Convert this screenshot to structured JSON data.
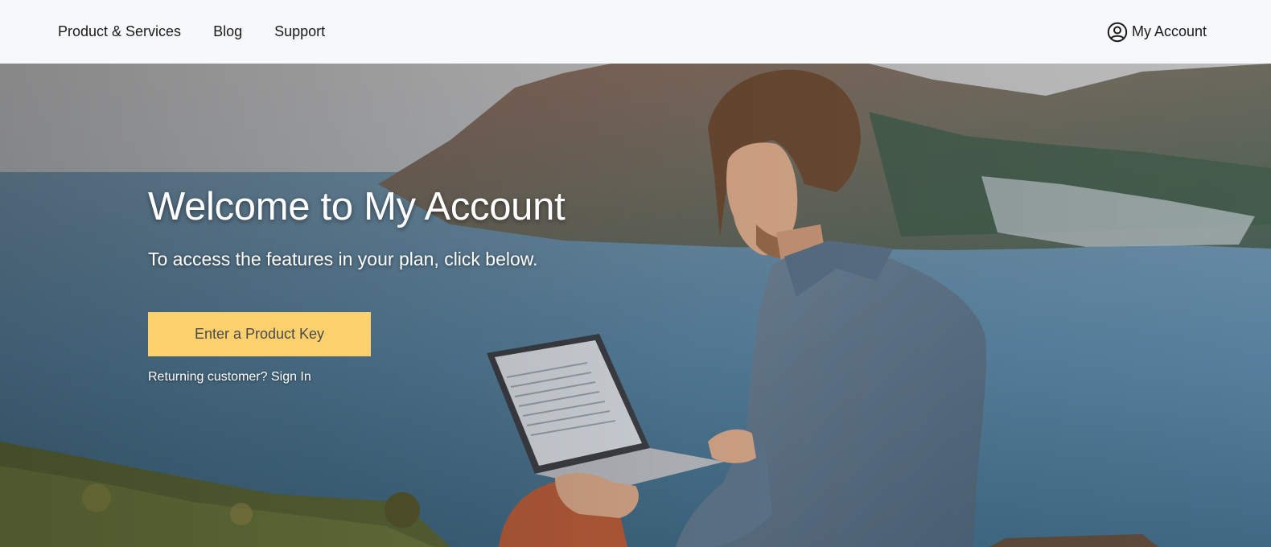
{
  "nav": {
    "items": [
      {
        "label": "Product & Services"
      },
      {
        "label": "Blog"
      },
      {
        "label": "Support"
      }
    ],
    "account_label": "My Account"
  },
  "hero": {
    "title": "Welcome to My Account",
    "subtitle": "To access the features in your plan, click below.",
    "cta_label": "Enter a Product Key",
    "signin_text": "Returning customer? Sign In"
  },
  "colors": {
    "topbar_bg": "#f7f8fa",
    "cta_bg": "#fcd16d",
    "text_dark": "#1b1b1b"
  }
}
